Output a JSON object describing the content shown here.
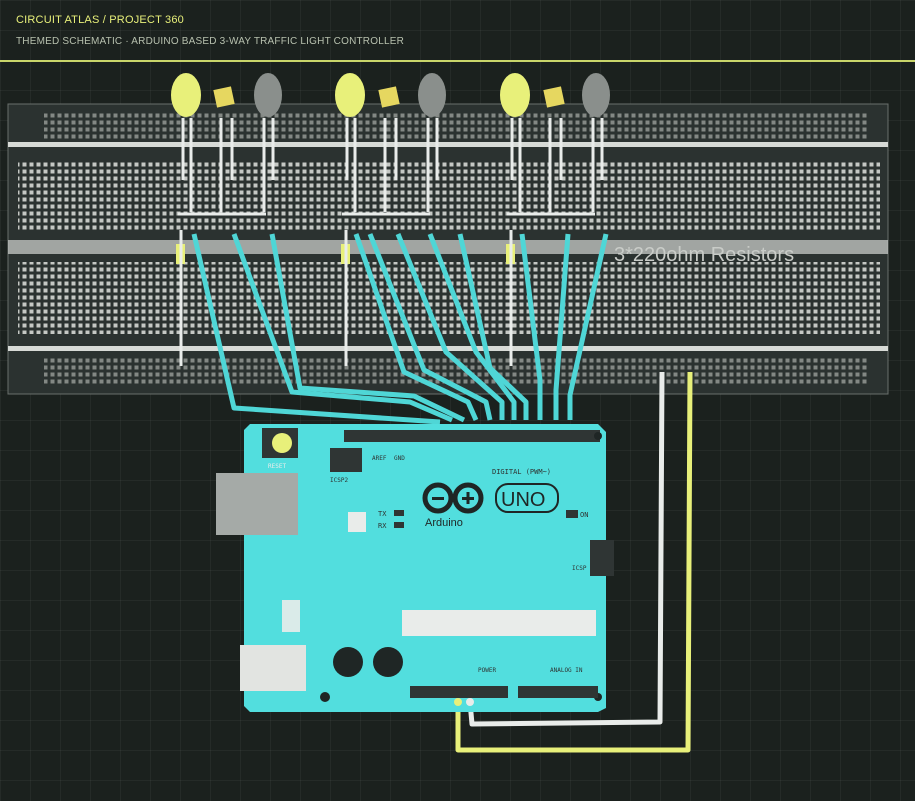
{
  "header": {
    "brand": "CIRCUIT ATLAS / PROJECT 360",
    "subtitle": "THEMED SCHEMATIC · ARDUINO BASED 3-WAY TRAFFIC LIGHT CONTROLLER"
  },
  "annotation": {
    "resistors": "3*220ohm Resistors"
  },
  "arduino": {
    "logo": "UNO",
    "brand": "Arduino",
    "reset": "RESET",
    "icsp2": "ICSP2",
    "icsp": "ICSP",
    "tx": "TX",
    "rx": "RX",
    "on": "ON",
    "digital": "DIGITAL (PWM~)",
    "power": "POWER",
    "analog": "ANALOG IN",
    "aref": "AREF",
    "gnd": "GND"
  },
  "colors": {
    "background": "#1b211e",
    "accent": "#e8f07a",
    "wire_cyan": "#4fd6d6",
    "board": "#52dede",
    "breadboard": "#2b3230",
    "led_yellow": "#e8f07a",
    "led_grey": "#8a8f8c"
  }
}
